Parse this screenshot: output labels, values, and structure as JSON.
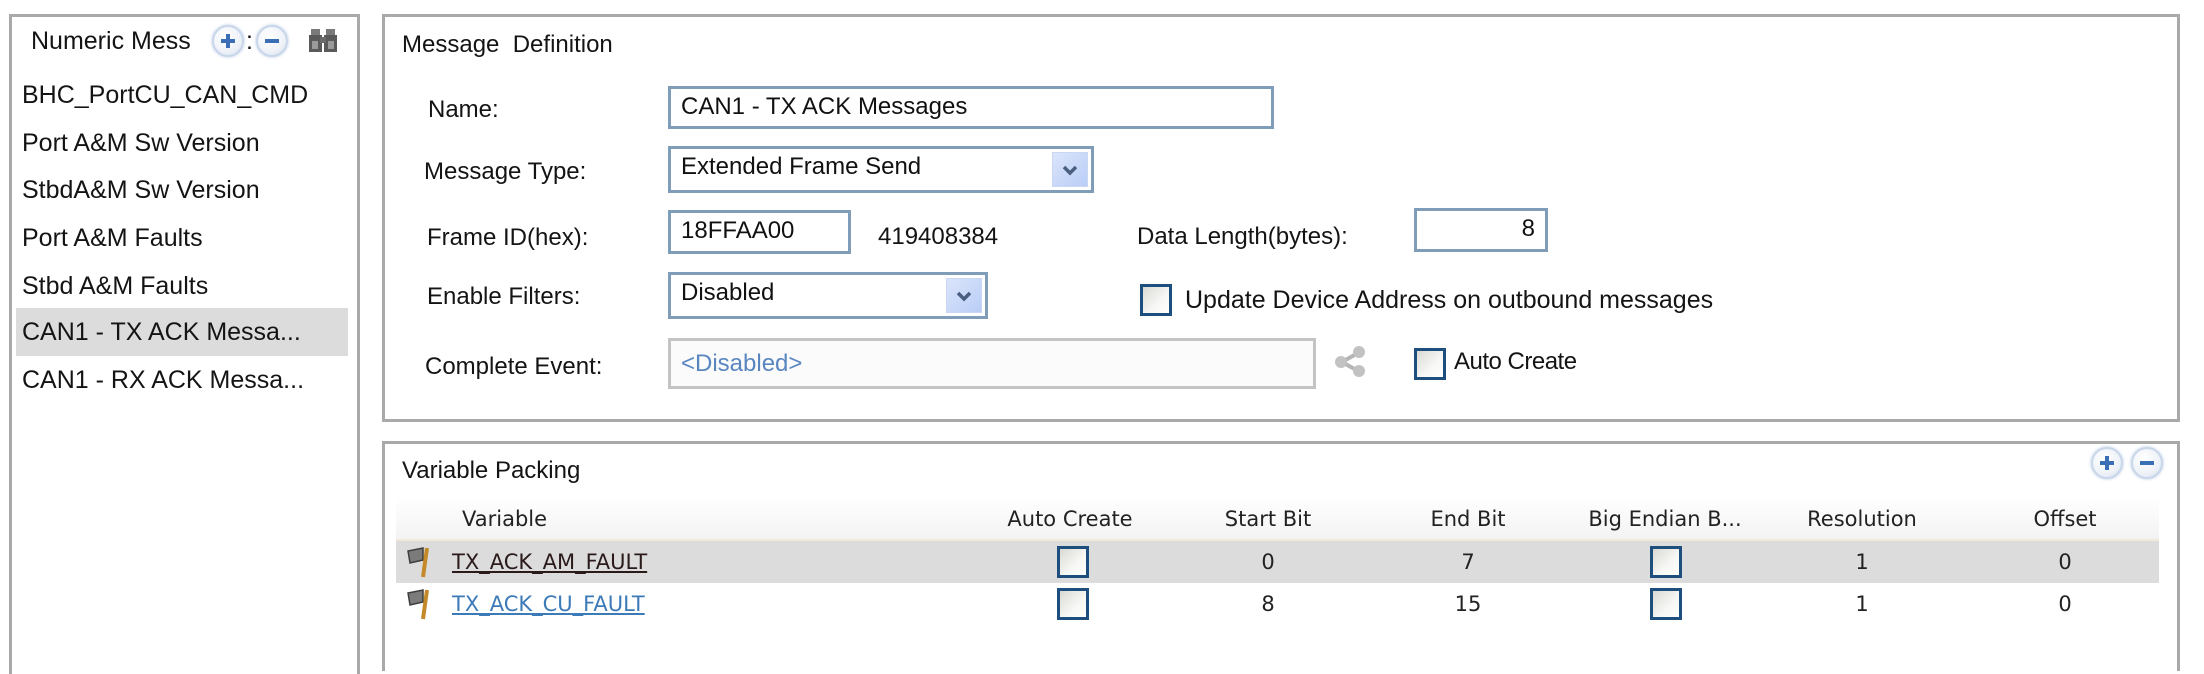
{
  "sidebar": {
    "header_label": "Numeric Mess",
    "header_sep": ":",
    "header_icons": [
      "plus-icon",
      "minus-icon",
      "binoculars-icon"
    ],
    "items": [
      {
        "label": "BHC_PortCU_CAN_CMD",
        "selected": false
      },
      {
        "label": "Port A&M Sw Version",
        "selected": false
      },
      {
        "label": "StbdA&M Sw Version",
        "selected": false
      },
      {
        "label": "Port A&M Faults",
        "selected": false
      },
      {
        "label": "Stbd A&M Faults",
        "selected": false
      },
      {
        "label": "CAN1 - TX ACK Messa...",
        "selected": true
      },
      {
        "label": "CAN1 - RX ACK Messa...",
        "selected": false
      }
    ]
  },
  "message_definition": {
    "title": "Message  Definition",
    "name_label": "Name:",
    "name_value": "CAN1 - TX ACK Messages",
    "message_type_label": "Message Type:",
    "message_type_value": "Extended Frame Send",
    "frame_id_label": "Frame ID(hex):",
    "frame_id_value": "18FFAA00",
    "frame_id_decimal": "419408384",
    "data_length_label": "Data Length(bytes):",
    "data_length_value": "8",
    "enable_filters_label": "Enable Filters:",
    "enable_filters_value": "Disabled",
    "update_device_address_label": "Update Device Address on outbound messages",
    "update_device_address_checked": false,
    "complete_event_label": "Complete Event:",
    "complete_event_value": "<Disabled>",
    "auto_create_label": "Auto Create",
    "auto_create_checked": false
  },
  "variable_packing": {
    "title": "Variable Packing",
    "columns": [
      "Variable",
      "Auto Create",
      "Start Bit",
      "End Bit",
      "Big Endian B...",
      "Resolution",
      "Offset"
    ],
    "rows": [
      {
        "variable": "TX_ACK_AM_FAULT",
        "auto_create": false,
        "start_bit": "0",
        "end_bit": "7",
        "big_endian": false,
        "resolution": "1",
        "offset": "0",
        "selected": true
      },
      {
        "variable": "TX_ACK_CU_FAULT",
        "auto_create": false,
        "start_bit": "8",
        "end_bit": "15",
        "big_endian": false,
        "resolution": "1",
        "offset": "0",
        "selected": false
      }
    ]
  },
  "colors": {
    "selected_row_bg": "#dcdcdc",
    "input_border": "#7f9db9",
    "link_blue": "#3d7ab8",
    "disabled_text": "#5a86c0"
  }
}
